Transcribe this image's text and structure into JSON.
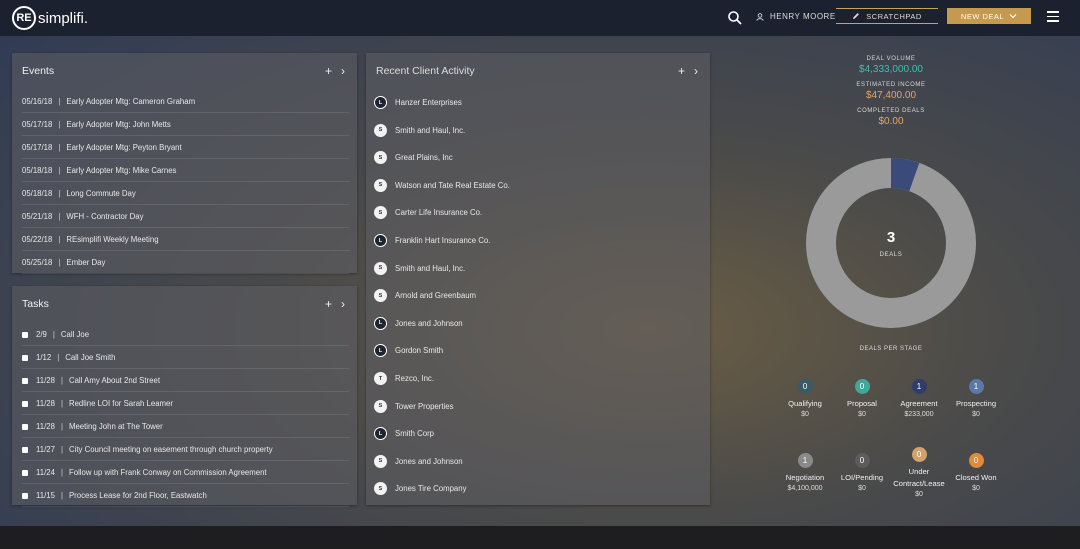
{
  "header": {
    "logo_circle": "RE",
    "logo_rest": "simplifi.",
    "user_name": "HENRY MOORE",
    "scratchpad_label": "SCRATCHPAD",
    "new_deal_label": "NEW DEAL",
    "icons": [
      "search-icon",
      "user-icon",
      "pencil-icon",
      "chevron-down-icon",
      "menu-icon"
    ]
  },
  "events": {
    "title": "Events",
    "items": [
      {
        "date": "05/16/18",
        "text": "Early Adopter Mtg: Cameron Graham"
      },
      {
        "date": "05/17/18",
        "text": "Early Adopter Mtg: John Metts"
      },
      {
        "date": "05/17/18",
        "text": "Early Adopter Mtg: Peyton Bryant"
      },
      {
        "date": "05/18/18",
        "text": "Early Adopter Mtg: Mike Carnes"
      },
      {
        "date": "05/18/18",
        "text": "Long Commute Day"
      },
      {
        "date": "05/21/18",
        "text": "WFH - Contractor Day"
      },
      {
        "date": "05/22/18",
        "text": "REsimplifi Weekly Meeting"
      },
      {
        "date": "05/25/18",
        "text": "Ember Day"
      }
    ]
  },
  "tasks": {
    "title": "Tasks",
    "items": [
      {
        "date": "2/9",
        "text": "Call Joe"
      },
      {
        "date": "1/12",
        "text": "Call Joe Smith"
      },
      {
        "date": "11/28",
        "text": "Call Amy About 2nd Street"
      },
      {
        "date": "11/28",
        "text": "Redline LOI for Sarah Leamer"
      },
      {
        "date": "11/28",
        "text": "Meeting John at The Tower"
      },
      {
        "date": "11/27",
        "text": "City Council meeting on easement through church property"
      },
      {
        "date": "11/24",
        "text": "Follow up with Frank Conway on Commission Agreement"
      },
      {
        "date": "11/15",
        "text": "Process Lease for 2nd Floor, Eastwatch"
      }
    ]
  },
  "activity": {
    "title": "Recent Client Activity",
    "items": [
      {
        "name": "Hanzer Enterprises",
        "badge": "L",
        "style": "dark"
      },
      {
        "name": "Smith and Haul, Inc.",
        "badge": "S",
        "style": "light"
      },
      {
        "name": "Great Plains, Inc",
        "badge": "S",
        "style": "light"
      },
      {
        "name": "Watson and Tate Real Estate Co.",
        "badge": "S",
        "style": "light"
      },
      {
        "name": "Carter Life Insurance Co.",
        "badge": "S",
        "style": "light"
      },
      {
        "name": "Franklin Hart Insurance Co.",
        "badge": "L",
        "style": "dark"
      },
      {
        "name": "Smith and Haul, Inc.",
        "badge": "S",
        "style": "light"
      },
      {
        "name": "Arnold and Greenbaum",
        "badge": "S",
        "style": "light"
      },
      {
        "name": "Jones and Johnson",
        "badge": "L",
        "style": "dark"
      },
      {
        "name": "Gordon Smith",
        "badge": "L",
        "style": "dark"
      },
      {
        "name": "Rezco, Inc.",
        "badge": "T",
        "style": "light"
      },
      {
        "name": "Tower Properties",
        "badge": "S",
        "style": "light"
      },
      {
        "name": "Smith Corp",
        "badge": "L",
        "style": "dark"
      },
      {
        "name": "Jones and Johnson",
        "badge": "S",
        "style": "light"
      },
      {
        "name": "Jones Tire Company",
        "badge": "S",
        "style": "light"
      }
    ]
  },
  "stats": {
    "deal_volume_label": "DEAL VOLUME",
    "deal_volume": "$4,333,000.00",
    "deal_volume_color": "#3fbfb0",
    "estimated_income_label": "ESTIMATED INCOME",
    "estimated_income": "$47,400.00",
    "estimated_income_color": "#f0a35a",
    "completed_deals_label": "COMPLETED DEALS",
    "completed_deals": "$0.00",
    "completed_deals_color": "#f0a35a"
  },
  "donut": {
    "count": "3",
    "label": "DEALS",
    "highlight_fraction": 0.054,
    "ring_color": "#9a9a9a",
    "highlight_color": "#3a4a7a"
  },
  "stages": {
    "caption": "DEALS PER STAGE",
    "items": [
      {
        "count": "0",
        "name": "Qualifying",
        "amount": "$0",
        "color": "#3a5a66"
      },
      {
        "count": "0",
        "name": "Proposal",
        "amount": "$0",
        "color": "#3fa898"
      },
      {
        "count": "1",
        "name": "Agreement",
        "amount": "$233,000",
        "color": "#2f3d6b"
      },
      {
        "count": "1",
        "name": "Prospecting",
        "amount": "$0",
        "color": "#5a78a8"
      },
      {
        "count": "1",
        "name": "Negotiation",
        "amount": "$4,100,000",
        "color": "#8a8a8a"
      },
      {
        "count": "0",
        "name": "LOI/Pending",
        "amount": "$0",
        "color": "#5c5c5c"
      },
      {
        "count": "0",
        "name": "Under Contract/Lease",
        "amount": "$0",
        "color": "#d3a26a"
      },
      {
        "count": "0",
        "name": "Closed Won",
        "amount": "$0",
        "color": "#e08a3c"
      }
    ]
  }
}
